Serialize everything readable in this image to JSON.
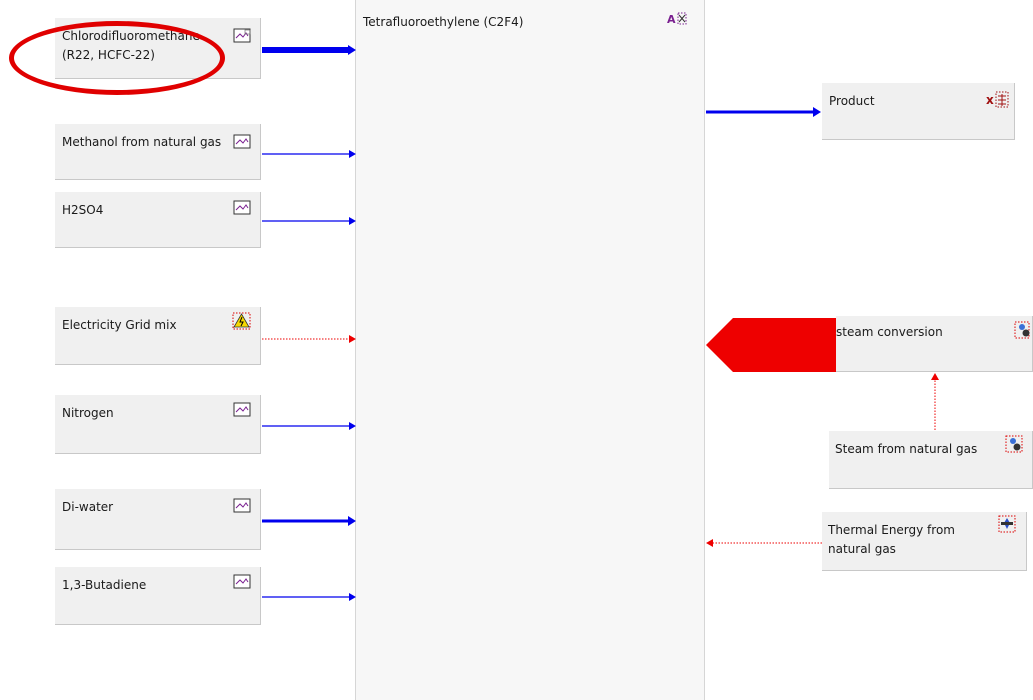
{
  "process": {
    "title": "Tetrafluoroethylene (C2F4)"
  },
  "inputs": [
    {
      "label": "Chlorodifluoromethane\n(R22, HCFC-22)"
    },
    {
      "label": "Methanol from natural gas"
    },
    {
      "label": "H2SO4"
    },
    {
      "label": "Electricity Grid mix"
    },
    {
      "label": "Nitrogen"
    },
    {
      "label": "Di-water"
    },
    {
      "label": "1,3-Butadiene"
    }
  ],
  "outputs": {
    "product": {
      "label": "Product"
    },
    "steam_conversion": {
      "label": "steam conversion"
    },
    "steam_from_natural_gas": {
      "label": "Steam from natural gas"
    },
    "thermal_energy": {
      "label": "Thermal Energy from\nnatural gas"
    }
  },
  "colors": {
    "material_flow": "#0000ee",
    "energy_flow": "#ee0000",
    "highlight": "#e00000"
  },
  "icons": {
    "plan": "plan-icon",
    "electricity": "electricity-mix-icon",
    "process": "process-A-icon",
    "product": "product-x-icon",
    "steam": "steam-icon",
    "thermal": "thermal-icon"
  }
}
